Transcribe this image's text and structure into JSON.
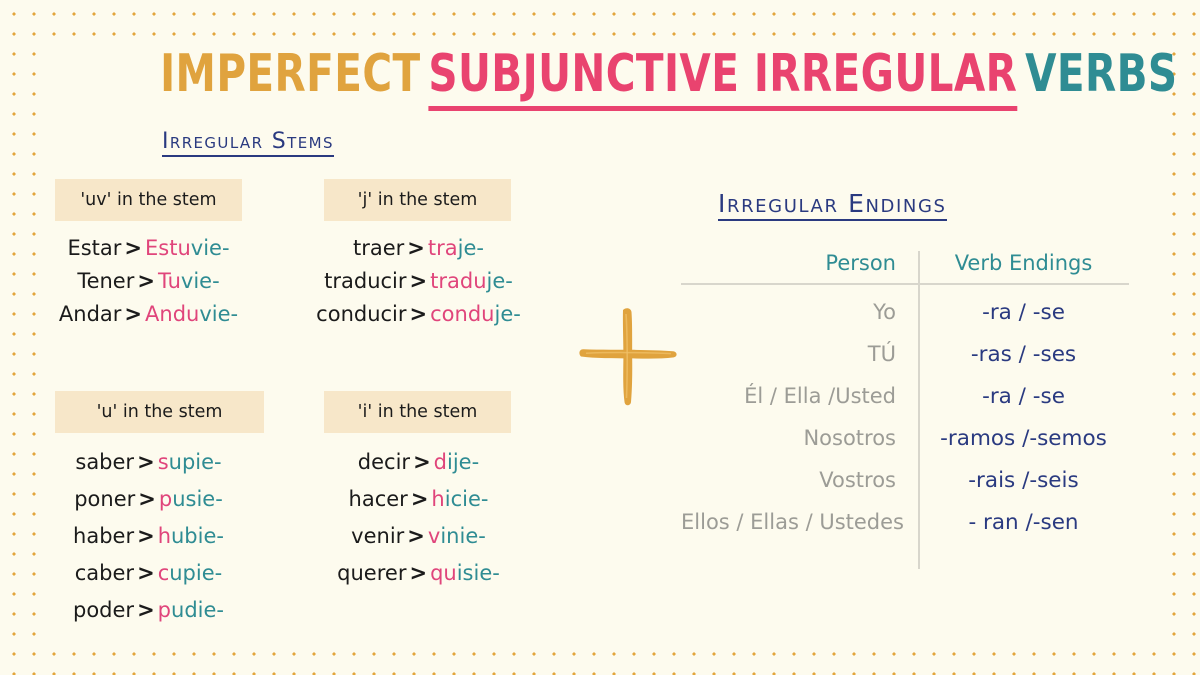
{
  "title": {
    "word1": "IMPERFECT",
    "word2": "SUBJUNCTIVE IRREGULAR",
    "word3": "VERBS"
  },
  "sections": {
    "stems_heading": "Irregular Stems",
    "endings_heading": "Irregular Endings"
  },
  "plus_symbol": "plus-sign",
  "stem_groups": [
    {
      "id": "uv",
      "chip": "'uv' in the stem",
      "verbs": [
        {
          "base": "Estar",
          "arrow": ">",
          "stem_a": "Estu",
          "stem_b": "vie-"
        },
        {
          "base": "Tener",
          "arrow": ">",
          "stem_a": "Tu",
          "stem_b": "vie-"
        },
        {
          "base": "Andar",
          "arrow": ">",
          "stem_a": "Andu",
          "stem_b": "vie-"
        }
      ]
    },
    {
      "id": "j",
      "chip": "'j' in the stem",
      "verbs": [
        {
          "base": "traer",
          "arrow": ">",
          "stem_a": "tra",
          "stem_b": "je-"
        },
        {
          "base": "traducir",
          "arrow": ">",
          "stem_a": "tradu",
          "stem_b": "je-"
        },
        {
          "base": "conducir",
          "arrow": ">",
          "stem_a": "condu",
          "stem_b": "je-"
        }
      ]
    },
    {
      "id": "u",
      "chip": "'u' in the stem",
      "verbs": [
        {
          "base": "saber",
          "arrow": ">",
          "stem_a": "s",
          "stem_b": "upie-"
        },
        {
          "base": "poner",
          "arrow": ">",
          "stem_a": "p",
          "stem_b": "usie-"
        },
        {
          "base": "haber",
          "arrow": ">",
          "stem_a": "h",
          "stem_b": "ubie-"
        },
        {
          "base": "caber",
          "arrow": ">",
          "stem_a": "c",
          "stem_b": "upie-"
        },
        {
          "base": "poder",
          "arrow": ">",
          "stem_a": "p",
          "stem_b": "udie-"
        }
      ]
    },
    {
      "id": "i",
      "chip": "'i' in the stem",
      "verbs": [
        {
          "base": "decir",
          "arrow": ">",
          "stem_a": "d",
          "stem_b": "ije-"
        },
        {
          "base": "hacer",
          "arrow": ">",
          "stem_a": "h",
          "stem_b": "icie-"
        },
        {
          "base": "venir",
          "arrow": ">",
          "stem_a": "v",
          "stem_b": "inie-"
        },
        {
          "base": "querer",
          "arrow": ">",
          "stem_a": "qu",
          "stem_b": "isie-"
        }
      ]
    }
  ],
  "endings_table": {
    "columns": [
      "Person",
      "Verb Endings"
    ],
    "rows": [
      {
        "person": "Yo",
        "ending": "-ra / -se"
      },
      {
        "person": "TÚ",
        "ending": "-ras / -ses"
      },
      {
        "person": "Él / Ella /Usted",
        "ending": "-ra / -se"
      },
      {
        "person": "Nosotros",
        "ending": "-ramos /-semos"
      },
      {
        "person": "Vostros",
        "ending": "-rais /-seis"
      },
      {
        "person": "Ellos / Ellas / Ustedes",
        "ending": "- ran /-sen"
      }
    ]
  },
  "colors": {
    "background": "#FDFBEE",
    "dots": "#E2A53C",
    "title_orange": "#E0A33E",
    "title_pink": "#E9436F",
    "title_teal": "#2F8C93",
    "heading_navy": "#2A3A80",
    "chip_bg": "#F7E7C9",
    "stem_pink": "#E0457B",
    "stem_teal": "#2F8C93",
    "person_gray": "#9C9C96",
    "ending_navy": "#2A3A80",
    "rule_gray": "#D8D6CC"
  }
}
